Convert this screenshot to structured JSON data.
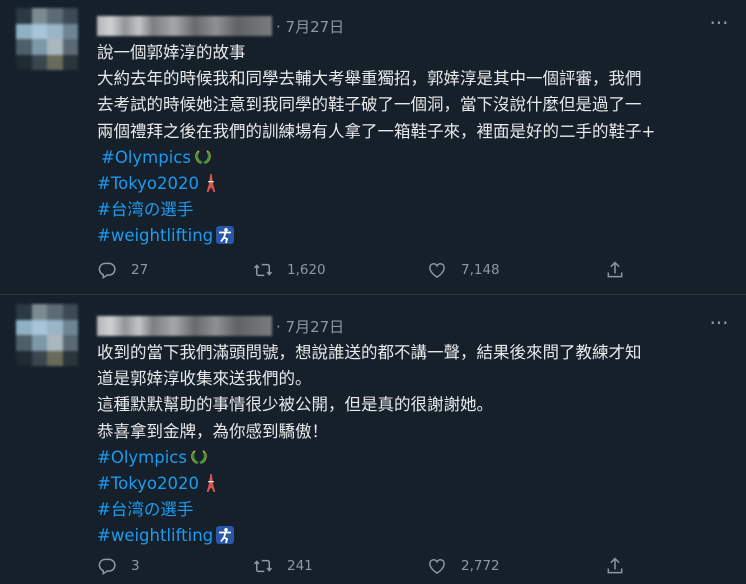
{
  "tweets": [
    {
      "date": "· 7月27日",
      "lines": [
        {
          "text": "說一個郭婞淳的故事"
        },
        {
          "text": "大約去年的時候我和同學去輔大考舉重獨招，郭婞淳是其中一個評審，我們"
        },
        {
          "text": "去考試的時候她注意到我同學的鞋子破了一個洞，當下沒說什麼但是過了一"
        },
        {
          "text": "兩個禮拜之後在我們的訓練場有人拿了一箱鞋子來，裡面是好的二手的鞋子+"
        }
      ],
      "hashtags": [
        "#Olympics",
        "#Tokyo2020",
        "#台湾の選手",
        "#weightlifting"
      ],
      "counts": {
        "replies": "27",
        "retweets": "1,620",
        "likes": "7,148"
      }
    },
    {
      "date": "· 7月27日",
      "lines": [
        {
          "text": "收到的當下我們滿頭問號，想說誰送的都不講一聲，結果後來問了教練才知"
        },
        {
          "text": "道是郭婞淳收集來送我們的。"
        },
        {
          "text": "這種默默幫助的事情很少被公開，但是真的很謝謝她。"
        },
        {
          "text": "恭喜拿到金牌，為你感到驕傲！"
        }
      ],
      "hashtags": [
        "#Olympics",
        "#Tokyo2020",
        "#台湾の選手",
        "#weightlifting"
      ],
      "counts": {
        "replies": "3",
        "retweets": "241",
        "likes": "2,772"
      }
    }
  ],
  "icons": {
    "more": "more-horizontal-icon",
    "reply": "reply-icon",
    "retweet": "retweet-icon",
    "like": "heart-icon",
    "share": "share-icon",
    "olympics_emoji": "olympic-laurel-icon",
    "tokyo_emoji": "tokyo-tower-icon",
    "weightlifting_emoji": "weightlifting-icon"
  },
  "colors": {
    "background": "#15202b",
    "text": "#e7e9ea",
    "muted": "#8b98a5",
    "link": "#1d9bf0"
  }
}
